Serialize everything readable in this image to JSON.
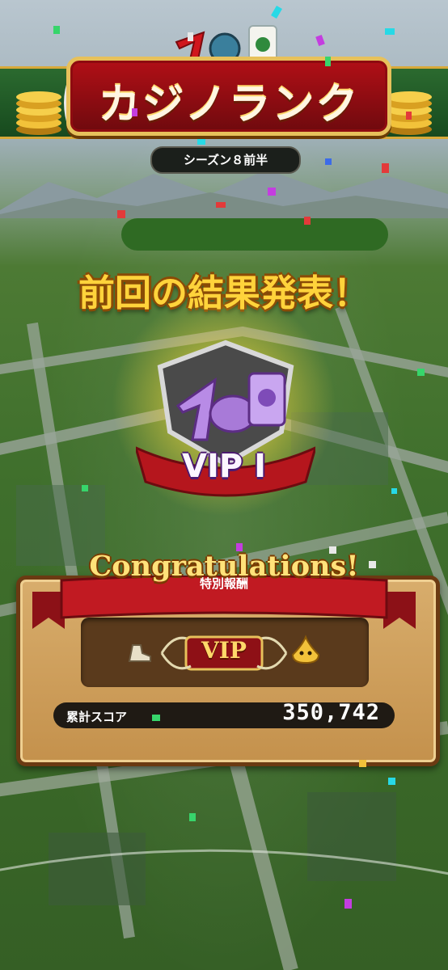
{
  "header": {
    "title": "カジノランク",
    "season_label": "シーズン８前半"
  },
  "main": {
    "headline": "前回の結果発表！",
    "rank_badge": "VIP I"
  },
  "reward_panel": {
    "banner_text": "Congratulations!",
    "subtitle": "特別報酬",
    "reward_plate": "VIP",
    "score_label": "累計スコア",
    "score_value": "350,742"
  },
  "colors": {
    "accent_gold": "#ffd33b",
    "banner_red": "#b10f16",
    "panel_tan": "#d8ad6c",
    "badge_purple": "#b88be6"
  }
}
